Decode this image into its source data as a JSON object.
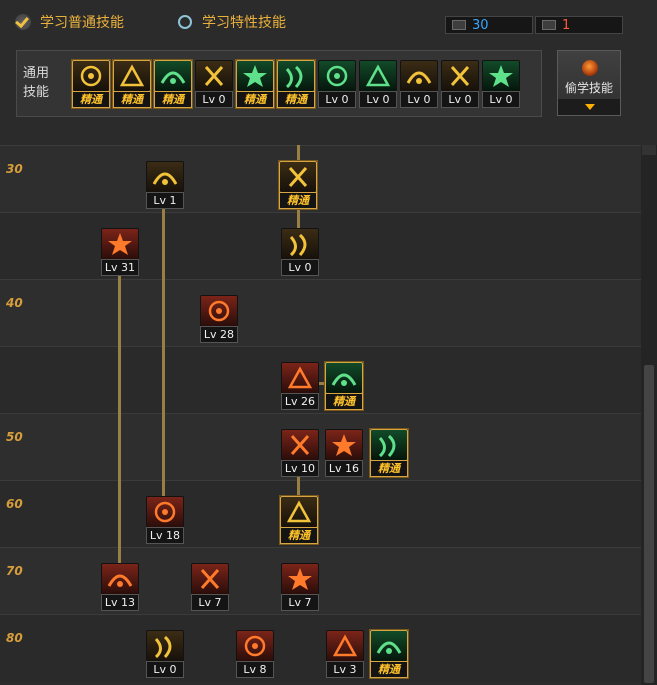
{
  "tabs": [
    {
      "label": "学习普通技能",
      "selected": true
    },
    {
      "label": "学习特性技能",
      "selected": false
    }
  ],
  "points": {
    "sp": "30",
    "tp": "1",
    "sp_color": "#36a8ff",
    "tp_color": "#ff5a40"
  },
  "common_skills": {
    "label": "通用技能",
    "items": [
      {
        "caption": "精通",
        "tier": "master",
        "theme": "gold",
        "icon": "sit-recover-icon"
      },
      {
        "caption": "精通",
        "tier": "master",
        "theme": "gold",
        "icon": "leap-strike-icon"
      },
      {
        "caption": "精通",
        "tier": "master",
        "theme": "green",
        "icon": "dash-kick-icon"
      },
      {
        "caption": "Lv 0",
        "tier": "level",
        "theme": "gold",
        "icon": "wing-icon"
      },
      {
        "caption": "精通",
        "tier": "master",
        "theme": "green",
        "icon": "target-icon"
      },
      {
        "caption": "精通",
        "tier": "master",
        "theme": "green",
        "icon": "crosshair-icon"
      },
      {
        "caption": "Lv 0",
        "tier": "level",
        "theme": "green",
        "icon": "wind-slash-icon"
      },
      {
        "caption": "Lv 0",
        "tier": "level",
        "theme": "green",
        "icon": "mana-icon"
      },
      {
        "caption": "Lv 0",
        "tier": "level",
        "theme": "gold",
        "icon": "aura-eye-icon"
      },
      {
        "caption": "Lv 0",
        "tier": "level",
        "theme": "gold",
        "icon": "power-up-icon"
      },
      {
        "caption": "Lv 0",
        "tier": "level",
        "theme": "green",
        "icon": "back-step-icon"
      }
    ]
  },
  "steal_button": {
    "label": "偷学技能"
  },
  "tree": {
    "level_labels": [
      "30",
      "",
      "40",
      "",
      "50",
      "60",
      "70",
      "80"
    ],
    "skills": [
      {
        "caption": "Lv 1",
        "tier": "level",
        "theme": "gold",
        "icon": "baseball-bat-icon"
      },
      {
        "caption": "精通",
        "tier": "master",
        "theme": "gold",
        "icon": "scorpion-icon"
      },
      {
        "caption": "Lv 31",
        "tier": "level",
        "theme": "red",
        "icon": "strike-flurry-icon"
      },
      {
        "caption": "Lv 0",
        "tier": "level",
        "theme": "gold",
        "icon": "flame-fist-icon"
      },
      {
        "caption": "Lv 28",
        "tier": "level",
        "theme": "red",
        "icon": "arm-bend-icon"
      },
      {
        "caption": "Lv 26",
        "tier": "level",
        "theme": "red",
        "icon": "hook-icon"
      },
      {
        "caption": "精通",
        "tier": "master",
        "theme": "green",
        "icon": "whirl-slash-icon"
      },
      {
        "caption": "Lv 10",
        "tier": "level",
        "theme": "red",
        "icon": "spartan-icon"
      },
      {
        "caption": "Lv 16",
        "tier": "level",
        "theme": "red",
        "icon": "pillar-burst-icon"
      },
      {
        "caption": "精通",
        "tier": "master",
        "theme": "green",
        "icon": "spartan-green-icon"
      },
      {
        "caption": "Lv 18",
        "tier": "level",
        "theme": "red",
        "icon": "burning-bat-icon"
      },
      {
        "caption": "精通",
        "tier": "master",
        "theme": "gold",
        "icon": "starburst-icon"
      },
      {
        "caption": "Lv 13",
        "tier": "level",
        "theme": "red",
        "icon": "vortex-icon"
      },
      {
        "caption": "Lv 7",
        "tier": "level",
        "theme": "red",
        "icon": "dragon-icon"
      },
      {
        "caption": "Lv 7",
        "tier": "level",
        "theme": "red",
        "icon": "archway-icon"
      },
      {
        "caption": "Lv 0",
        "tier": "level",
        "theme": "gold",
        "icon": "spiral-icon"
      },
      {
        "caption": "Lv 8",
        "tier": "level",
        "theme": "red",
        "icon": "fire-slash-icon"
      },
      {
        "caption": "Lv 3",
        "tier": "level",
        "theme": "red",
        "icon": "crimson-burst-icon"
      },
      {
        "caption": "精通",
        "tier": "master",
        "theme": "green",
        "icon": "spider-icon"
      }
    ]
  }
}
